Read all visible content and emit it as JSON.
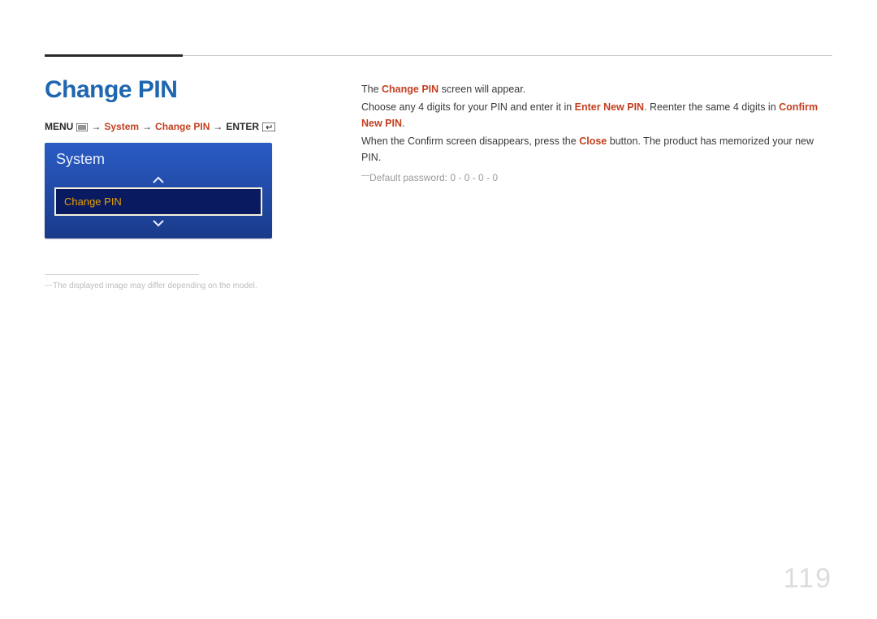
{
  "page": {
    "title": "Change PIN",
    "number": "119"
  },
  "nav": {
    "menu_label": "MENU",
    "arrow": "→",
    "system": "System",
    "change_pin": "Change PIN",
    "enter_label": "ENTER"
  },
  "menubox": {
    "header": "System",
    "item": "Change PIN"
  },
  "footnote": "The displayed image may differ depending on the model.",
  "body": {
    "line1_a": "The ",
    "line1_b": "Change PIN",
    "line1_c": " screen will appear.",
    "line2_a": "Choose any 4 digits for your PIN and enter it in ",
    "line2_b": "Enter New PIN",
    "line2_c": ". Reenter the same 4 digits in ",
    "line2_d": "Confirm New PIN",
    "line2_e": ".",
    "line3_a": "When the Confirm screen disappears, press the ",
    "line3_b": "Close",
    "line3_c": " button. The product has memorized your new PIN.",
    "note": "Default password: 0 - 0 - 0 - 0"
  }
}
